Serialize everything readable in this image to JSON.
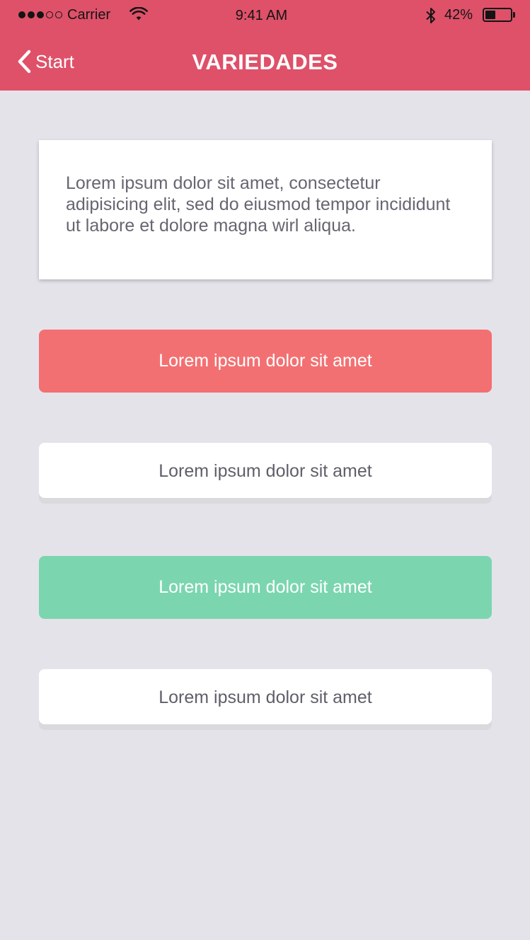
{
  "status_bar": {
    "carrier": "Carrier",
    "time": "9:41 AM",
    "battery_percent": "42%",
    "battery_level": 0.42,
    "signal_bars_filled": 3,
    "signal_bars_total": 5,
    "icons": [
      "wifi-icon",
      "bluetooth-icon",
      "battery-icon"
    ]
  },
  "nav": {
    "back_label": "Start",
    "back_icon": "chevron-left-icon",
    "title": "VARIEDADES"
  },
  "card": {
    "text": "Lorem ipsum dolor sit amet, consectetur adipisicing elit, sed do eiusmod tempor incididunt ut labore et dolore magna wirl aliqua."
  },
  "buttons": [
    {
      "label": "Lorem ipsum dolor sit amet",
      "style": "red"
    },
    {
      "label": "Lorem ipsum dolor sit amet",
      "style": "white"
    },
    {
      "label": "Lorem ipsum dolor sit amet",
      "style": "green"
    },
    {
      "label": "Lorem ipsum dolor sit amet",
      "style": "white"
    }
  ],
  "colors": {
    "header": "#de5169",
    "background": "#e5e3ea",
    "red_button": "#f37072",
    "green_button": "#7bd6b0",
    "white_button": "#ffffff",
    "text_dark": "#5f5f69"
  }
}
